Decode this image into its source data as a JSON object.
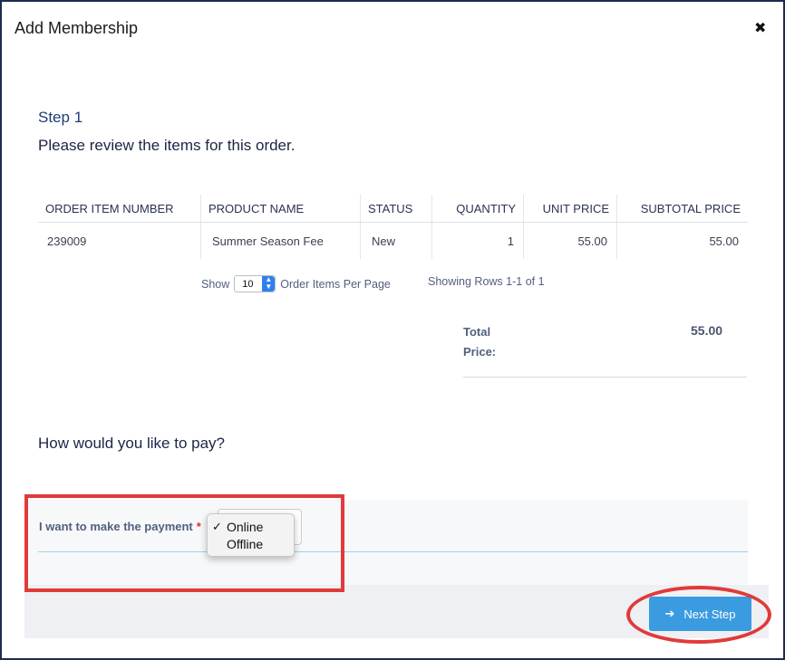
{
  "modal": {
    "title": "Add Membership",
    "close_glyph": "✖"
  },
  "step": {
    "label": "Step 1",
    "instruction": "Please review the items for this order."
  },
  "table": {
    "headers": [
      "ORDER ITEM NUMBER",
      "PRODUCT NAME",
      "STATUS",
      "QUANTITY",
      "UNIT PRICE",
      "SUBTOTAL PRICE"
    ],
    "rows": [
      [
        "239009",
        "Summer Season Fee",
        "New",
        "1",
        "55.00",
        "55.00"
      ]
    ]
  },
  "pager": {
    "show_label": "Show",
    "per_page_value": "10",
    "per_page_suffix": "Order Items Per Page",
    "showing_text": "Showing Rows 1-1 of 1"
  },
  "total": {
    "label": "Total Price:",
    "value": "55.00"
  },
  "payment": {
    "question": "How would you like to pay?",
    "field_label": "I want to make the payment",
    "required_mark": "*",
    "options": [
      "Online",
      "Offline"
    ],
    "selected": "Online",
    "check_glyph": "✓"
  },
  "footer": {
    "next_label": "Next Step",
    "next_icon": "arrow-right-icon"
  },
  "colors": {
    "accent": "#3a9be0",
    "annotation": "#e03a3a",
    "heading": "#1e3c78"
  }
}
